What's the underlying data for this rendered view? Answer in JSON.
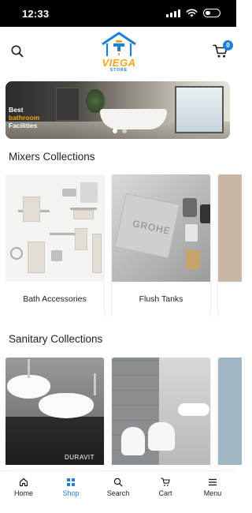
{
  "status_bar": {
    "time": "12:33"
  },
  "header": {
    "logo_text": "VIEGA",
    "logo_subtext": "STORE",
    "cart_count": "0"
  },
  "banner": {
    "line1": "Best",
    "line2": "bathroom",
    "line3": "Facilities",
    "slides": 2,
    "active_slide": 0
  },
  "sections": [
    {
      "title": "Mixers Collections",
      "items": [
        {
          "label": "Bath Accessories"
        },
        {
          "label": "Flush Tanks"
        },
        {
          "label": ""
        }
      ]
    },
    {
      "title": "Sanitary Collections",
      "items": [
        {
          "label": "",
          "brand": "DURAVIT"
        },
        {
          "label": ""
        },
        {
          "label": ""
        }
      ]
    }
  ],
  "bottom_nav": {
    "items": [
      {
        "label": "Home",
        "icon": "home-icon"
      },
      {
        "label": "Shop",
        "icon": "shop-grid-icon",
        "active": true
      },
      {
        "label": "Search",
        "icon": "search-icon"
      },
      {
        "label": "Cart",
        "icon": "cart-icon"
      },
      {
        "label": "Menu",
        "icon": "menu-icon"
      }
    ]
  },
  "colors": {
    "accent": "#1e7fd6",
    "brand_orange": "#f2a51a"
  }
}
